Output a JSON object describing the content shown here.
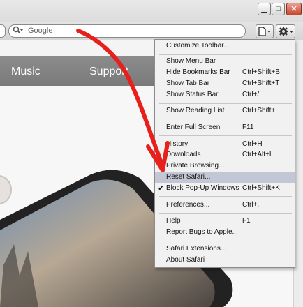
{
  "toolbar": {
    "search_placeholder": "Google"
  },
  "page": {
    "nav": [
      "Music",
      "Support"
    ]
  },
  "menu": {
    "items": [
      {
        "label": "Customize Toolbar...",
        "shortcut": ""
      },
      {
        "label": "Show Menu Bar",
        "shortcut": ""
      },
      {
        "label": "Hide Bookmarks Bar",
        "shortcut": "Ctrl+Shift+B"
      },
      {
        "label": "Show Tab Bar",
        "shortcut": "Ctrl+Shift+T"
      },
      {
        "label": "Show Status Bar",
        "shortcut": "Ctrl+/"
      },
      {
        "label": "Show Reading List",
        "shortcut": "Ctrl+Shift+L"
      },
      {
        "label": "Enter Full Screen",
        "shortcut": "F11"
      },
      {
        "label": "History",
        "shortcut": "Ctrl+H"
      },
      {
        "label": "Downloads",
        "shortcut": "Ctrl+Alt+L"
      },
      {
        "label": "Private Browsing...",
        "shortcut": ""
      },
      {
        "label": "Reset Safari...",
        "shortcut": ""
      },
      {
        "label": "Block Pop-Up Windows",
        "shortcut": "Ctrl+Shift+K",
        "checked": true
      },
      {
        "label": "Preferences...",
        "shortcut": "Ctrl+,"
      },
      {
        "label": "Help",
        "shortcut": "F1"
      },
      {
        "label": "Report Bugs to Apple...",
        "shortcut": ""
      },
      {
        "label": "Safari Extensions...",
        "shortcut": ""
      },
      {
        "label": "About Safari",
        "shortcut": ""
      }
    ],
    "highlighted": "Reset Safari..."
  },
  "colors": {
    "annotation_arrow": "#e8201c",
    "nav_bar": "#808080",
    "menu_highlight": "#c3c6d4"
  }
}
